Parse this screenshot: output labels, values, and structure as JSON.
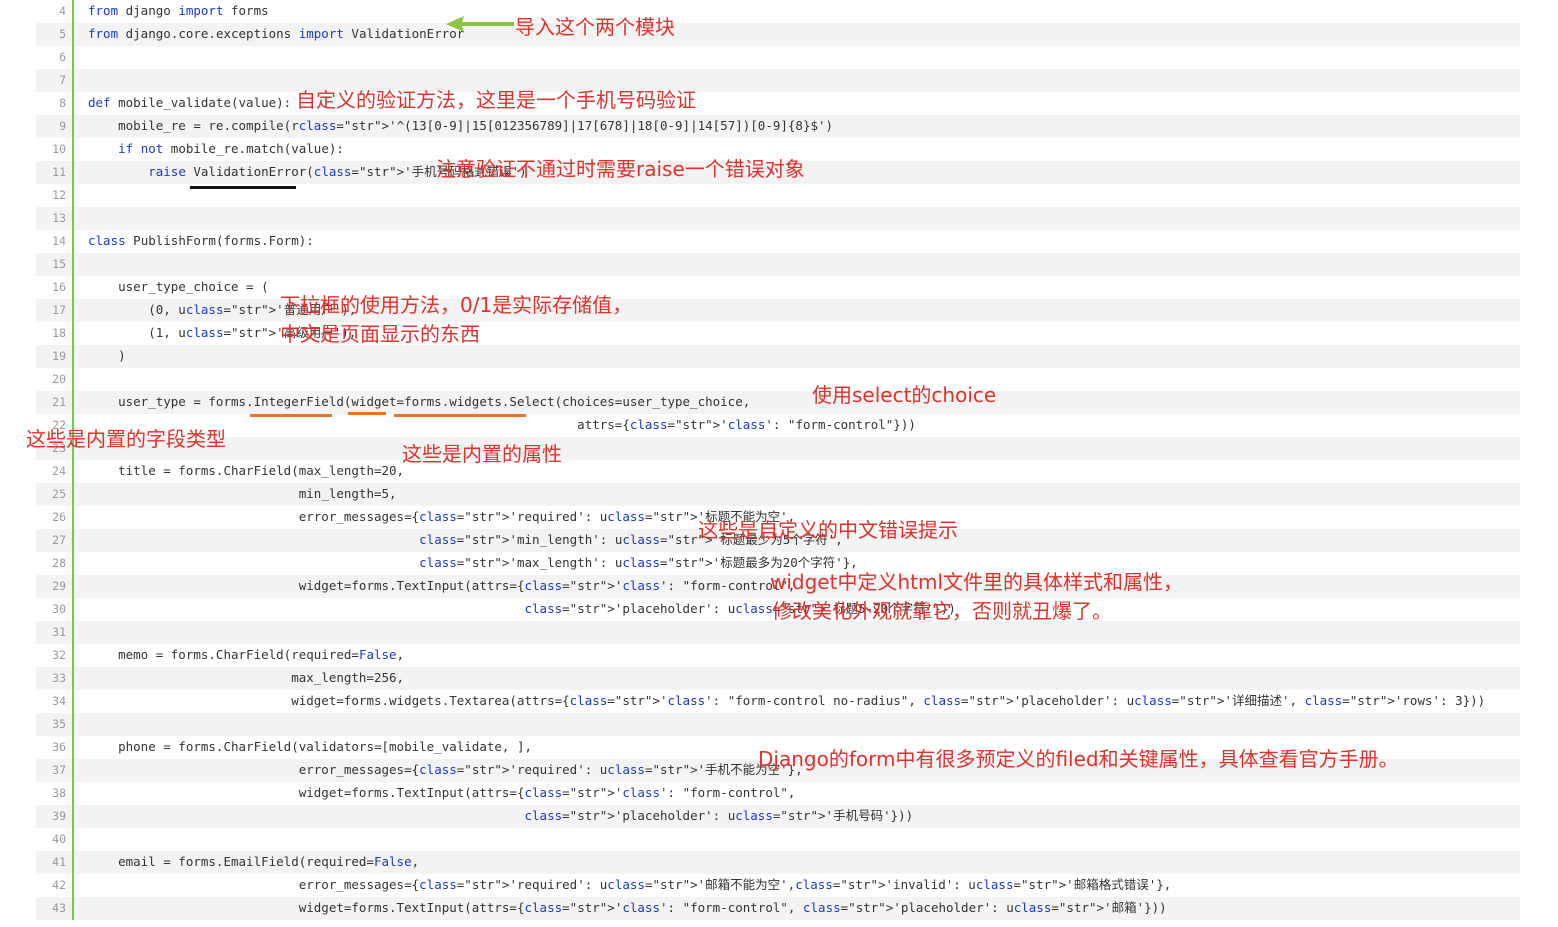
{
  "lines": [
    {
      "n": "4",
      "code": "from django import forms"
    },
    {
      "n": "5",
      "code": "from django.core.exceptions import ValidationError"
    },
    {
      "n": "6",
      "code": ""
    },
    {
      "n": "7",
      "code": ""
    },
    {
      "n": "8",
      "code": "def mobile_validate(value):"
    },
    {
      "n": "9",
      "code": "    mobile_re = re.compile(r'^(13[0-9]|15[012356789]|17[678]|18[0-9]|14[57])[0-9]{8}$')"
    },
    {
      "n": "10",
      "code": "    if not mobile_re.match(value):"
    },
    {
      "n": "11",
      "code": "        raise ValidationError('手机号码格式错误')"
    },
    {
      "n": "12",
      "code": ""
    },
    {
      "n": "13",
      "code": ""
    },
    {
      "n": "14",
      "code": "class PublishForm(forms.Form):"
    },
    {
      "n": "15",
      "code": ""
    },
    {
      "n": "16",
      "code": "    user_type_choice = ("
    },
    {
      "n": "17",
      "code": "        (0, u'普通用户'),"
    },
    {
      "n": "18",
      "code": "        (1, u'高级用户'),"
    },
    {
      "n": "19",
      "code": "    )"
    },
    {
      "n": "20",
      "code": ""
    },
    {
      "n": "21",
      "code": "    user_type = forms.IntegerField(widget=forms.widgets.Select(choices=user_type_choice,"
    },
    {
      "n": "22",
      "code": "                                                                 attrs={'class': \"form-control\"}))"
    },
    {
      "n": "23",
      "code": ""
    },
    {
      "n": "24",
      "code": "    title = forms.CharField(max_length=20,"
    },
    {
      "n": "25",
      "code": "                            min_length=5,"
    },
    {
      "n": "26",
      "code": "                            error_messages={'required': u'标题不能为空',"
    },
    {
      "n": "27",
      "code": "                                            'min_length': u'标题最少为5个字符',"
    },
    {
      "n": "28",
      "code": "                                            'max_length': u'标题最多为20个字符'},"
    },
    {
      "n": "29",
      "code": "                            widget=forms.TextInput(attrs={'class': \"form-control\","
    },
    {
      "n": "30",
      "code": "                                                          'placeholder': u'标题5-20个字符'}))"
    },
    {
      "n": "31",
      "code": ""
    },
    {
      "n": "32",
      "code": "    memo = forms.CharField(required=False,"
    },
    {
      "n": "33",
      "code": "                           max_length=256,"
    },
    {
      "n": "34",
      "code": "                           widget=forms.widgets.Textarea(attrs={'class': \"form-control no-radius\", 'placeholder': u'详细描述', 'rows': 3}))"
    },
    {
      "n": "35",
      "code": ""
    },
    {
      "n": "36",
      "code": "    phone = forms.CharField(validators=[mobile_validate, ],"
    },
    {
      "n": "37",
      "code": "                            error_messages={'required': u'手机不能为空'},"
    },
    {
      "n": "38",
      "code": "                            widget=forms.TextInput(attrs={'class': \"form-control\","
    },
    {
      "n": "39",
      "code": "                                                          'placeholder': u'手机号码'}))"
    },
    {
      "n": "40",
      "code": ""
    },
    {
      "n": "41",
      "code": "    email = forms.EmailField(required=False,"
    },
    {
      "n": "42",
      "code": "                            error_messages={'required': u'邮箱不能为空','invalid': u'邮箱格式错误'},"
    },
    {
      "n": "43",
      "code": "                            widget=forms.TextInput(attrs={'class': \"form-control\", 'placeholder': u'邮箱'}))"
    }
  ],
  "annotations": {
    "import_note": "导入这个两个模块",
    "validate_note": "自定义的验证方法，这里是一个手机号码验证",
    "raise_note": "注意验证不通过时需要raise一个错误对象",
    "select_note_1": "下拉框的使用方法，0/1是实际存储值，",
    "select_note_2": "中文是页面显示的东西",
    "choice_note": "使用select的choice",
    "field_type_note": "这些是内置的字段类型",
    "builtin_attr_note": "这些是内置的属性",
    "error_msg_note": "这些是自定义的中文错误提示",
    "widget_note_1": "widget中定义html文件里的具体样式和属性，",
    "widget_note_2": "修改美化外观就靠它，否则就丑爆了。",
    "django_note": "Django的form中有很多预定义的filed和关键属性，具体查看官方手册。"
  },
  "colors": {
    "annotation": "#e0312d",
    "gutter": "#6ccf4a",
    "keyword": "#1d38c2",
    "orange_underline": "#e8742c",
    "black_underline": "#111111",
    "arrow": "#8cc63f"
  }
}
